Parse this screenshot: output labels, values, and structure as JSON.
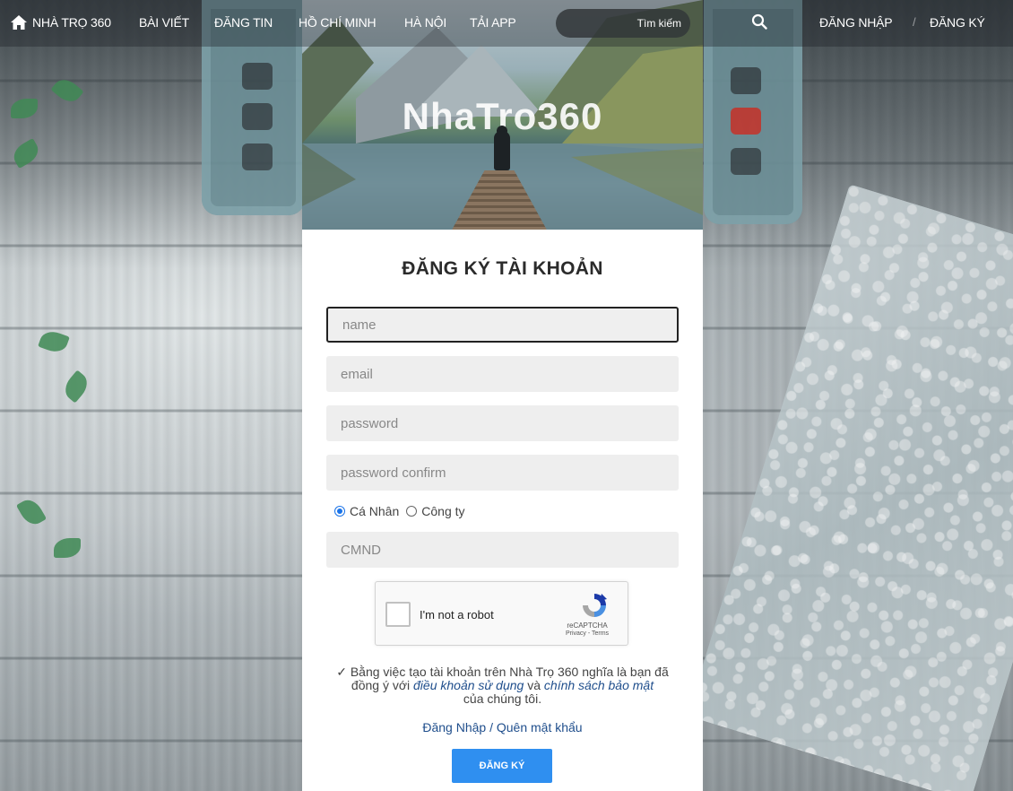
{
  "nav": {
    "home_label": "NHÀ TRỌ 360",
    "items": [
      "BÀI VIẾT",
      "ĐĂNG TIN",
      "HỒ CHÍ MINH",
      "HÀ NỘI",
      "TẢI APP"
    ],
    "search_placeholder": "Tìm kiếm",
    "login_label": "ĐĂNG NHẬP",
    "separator": "/",
    "register_label": "ĐĂNG KÝ"
  },
  "hero": {
    "title": "NhaTro360"
  },
  "form": {
    "title": "ĐĂNG KÝ TÀI KHOẢN",
    "name_placeholder": "name",
    "email_placeholder": "email",
    "password_placeholder": "password",
    "password_confirm_placeholder": "password confirm",
    "account_types": [
      {
        "label": "Cá Nhân",
        "checked": true
      },
      {
        "label": "Công ty",
        "checked": false
      }
    ],
    "id_placeholder": "CMND",
    "recaptcha": {
      "label": "I'm not a robot",
      "brand": "reCAPTCHA",
      "links": "Privacy - Terms"
    },
    "terms": {
      "prefix": "✓ Bằng việc tạo tài khoản trên Nhà Trọ 360 nghĩa là bạn đã đồng ý với",
      "terms_link": "điều khoản sử dụng",
      "middle": "và",
      "privacy_link": "chính sách bảo mật",
      "suffix": "của chúng tôi."
    },
    "login_forgot_link": "Đăng Nhập / Quên mật khẩu",
    "submit_label": "ĐĂNG KÝ"
  },
  "colors": {
    "accent": "#2f8ff0",
    "link": "#1f4e8c"
  }
}
